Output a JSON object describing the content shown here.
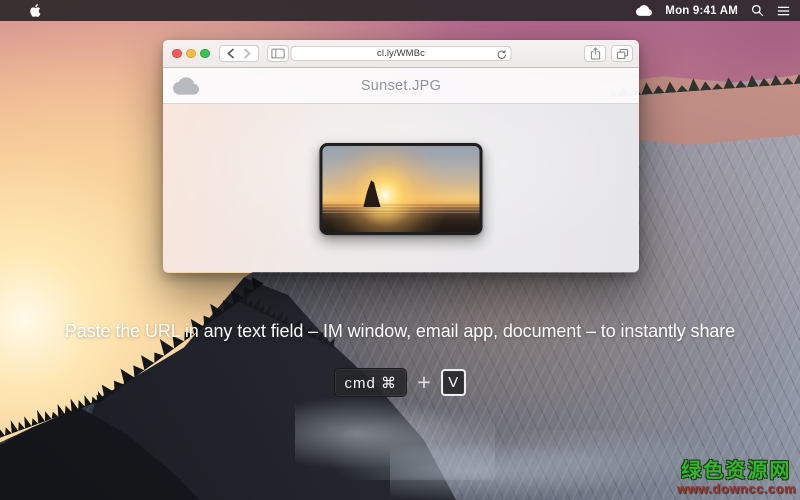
{
  "menu_bar": {
    "clock": "Mon 9:41 AM"
  },
  "browser": {
    "url": "cl.ly/WMBc"
  },
  "page": {
    "title": "Sunset.JPG"
  },
  "caption": {
    "text": "Paste the URL in any text field – IM window, email app, document – to instantly share"
  },
  "keys": {
    "cmd": "cmd ⌘",
    "plus": "+",
    "v": "V"
  },
  "watermark": {
    "title": "绿色资源网",
    "url": "www.downcc.com"
  },
  "colors": {
    "traffic_red": "#fc5a55",
    "traffic_yellow": "#fdbd3f",
    "traffic_green": "#35c84b",
    "menubar_bg": "#322a2d",
    "watermark_green": "#33b42f",
    "watermark_red": "#a33527"
  }
}
